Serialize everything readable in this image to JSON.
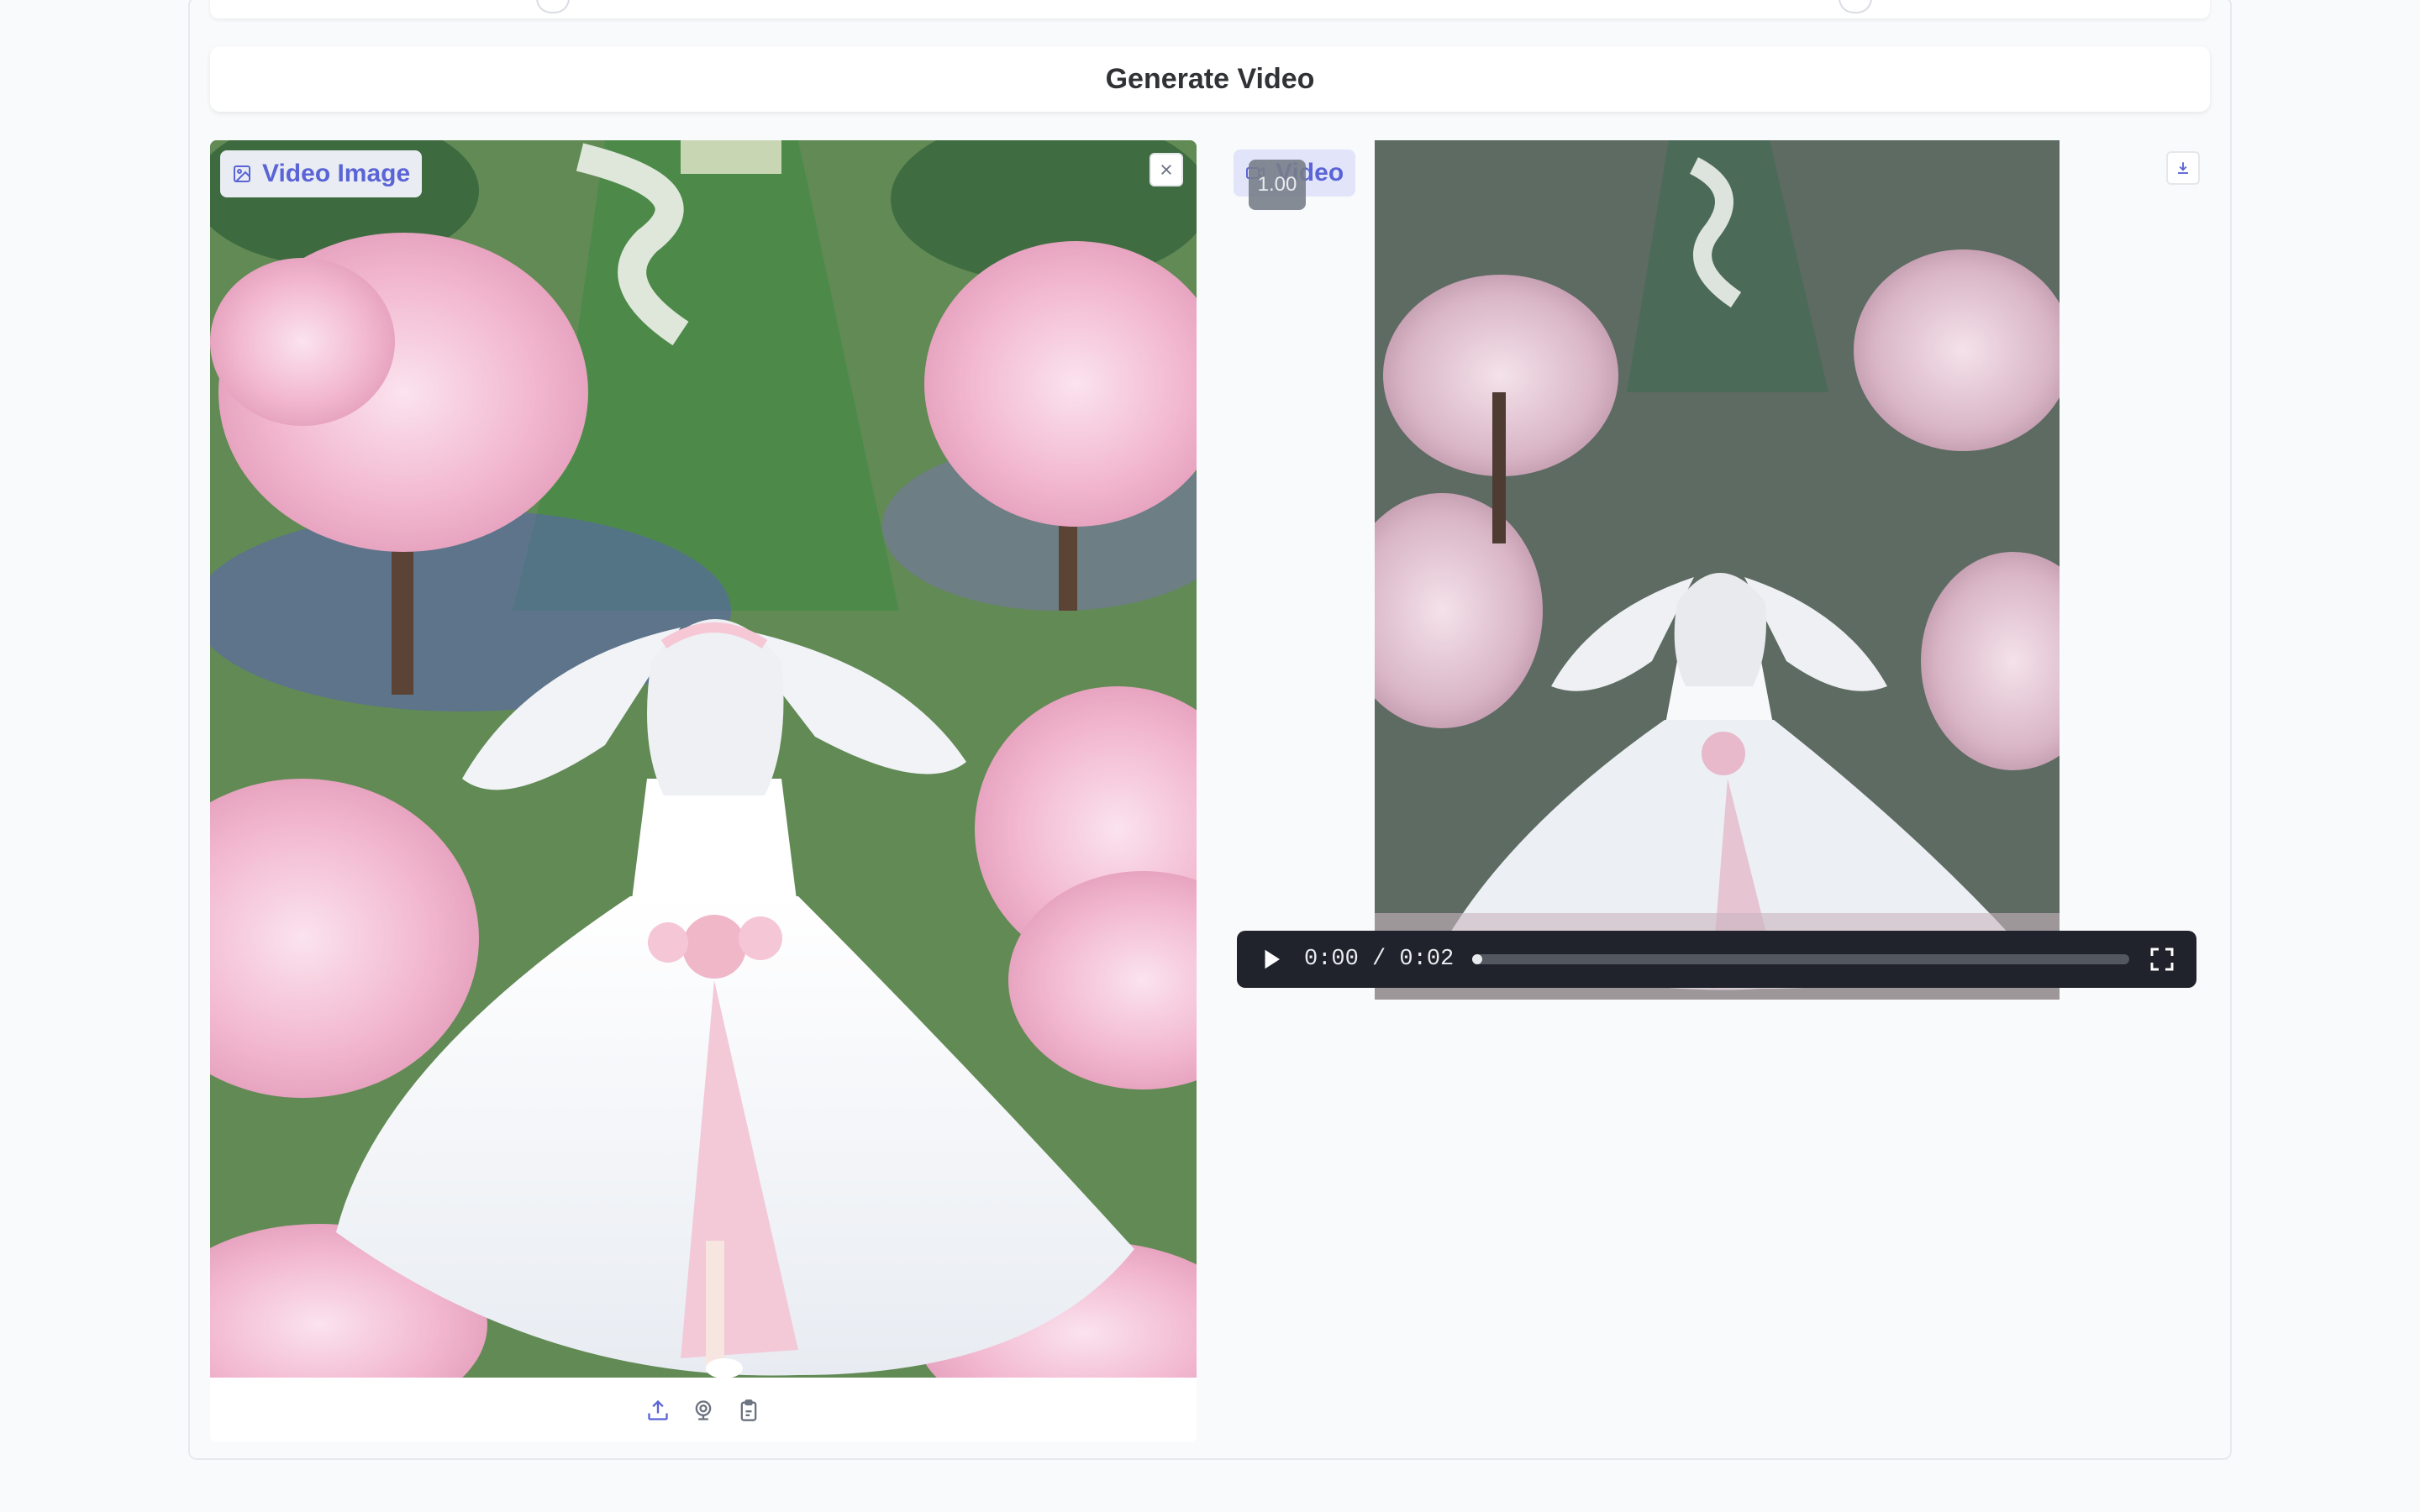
{
  "generate": {
    "label": "Generate Video"
  },
  "image_panel": {
    "label": "Video Image",
    "icon": "image-icon",
    "toolbar_icons": [
      "upload-icon",
      "webcam-icon",
      "clipboard-icon"
    ]
  },
  "video_panel": {
    "label": "Video",
    "icon": "video-icon",
    "speed": "1.00",
    "time": "0:00 / 0:02",
    "progress": 0.01
  },
  "colors": {
    "accent": "#5a64d6",
    "player_bg": "#20232b",
    "page_bg": "#f9fafc"
  }
}
